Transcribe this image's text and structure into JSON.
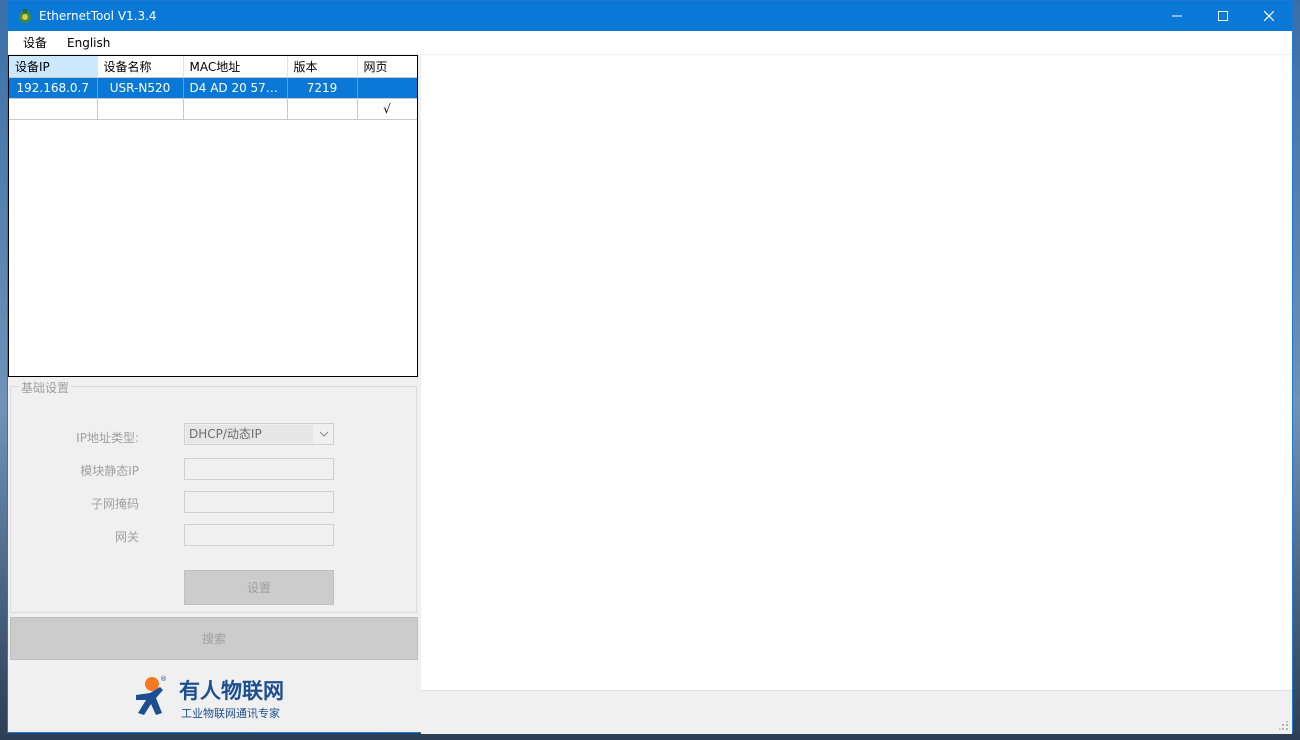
{
  "window": {
    "title": "EthernetTool V1.3.4"
  },
  "menu": {
    "items": [
      "设备",
      "English"
    ]
  },
  "grid": {
    "columns": [
      "设备IP",
      "设备名称",
      "MAC地址",
      "版本",
      "网页"
    ],
    "rows": [
      {
        "ip": "192.168.0.7",
        "name": "USR-N520",
        "mac": "D4 AD 20 57 A...",
        "version": "7219",
        "web": ""
      },
      {
        "ip": "",
        "name": "",
        "mac": "",
        "version": "",
        "web": "√"
      }
    ]
  },
  "basic_settings": {
    "title": "基础设置",
    "ip_type_label": "IP地址类型:",
    "ip_type_value": "DHCP/动态IP",
    "static_ip_label": "模块静态IP",
    "subnet_label": "子网掩码",
    "gateway_label": "网关",
    "set_button": "设置"
  },
  "search_button": "搜索",
  "logo": {
    "main": "有人物联网",
    "sub": "工业物联网通讯专家"
  },
  "colors": {
    "accent": "#0a78d7",
    "logo": "#1c4f91",
    "logo_head": "#f47920"
  }
}
